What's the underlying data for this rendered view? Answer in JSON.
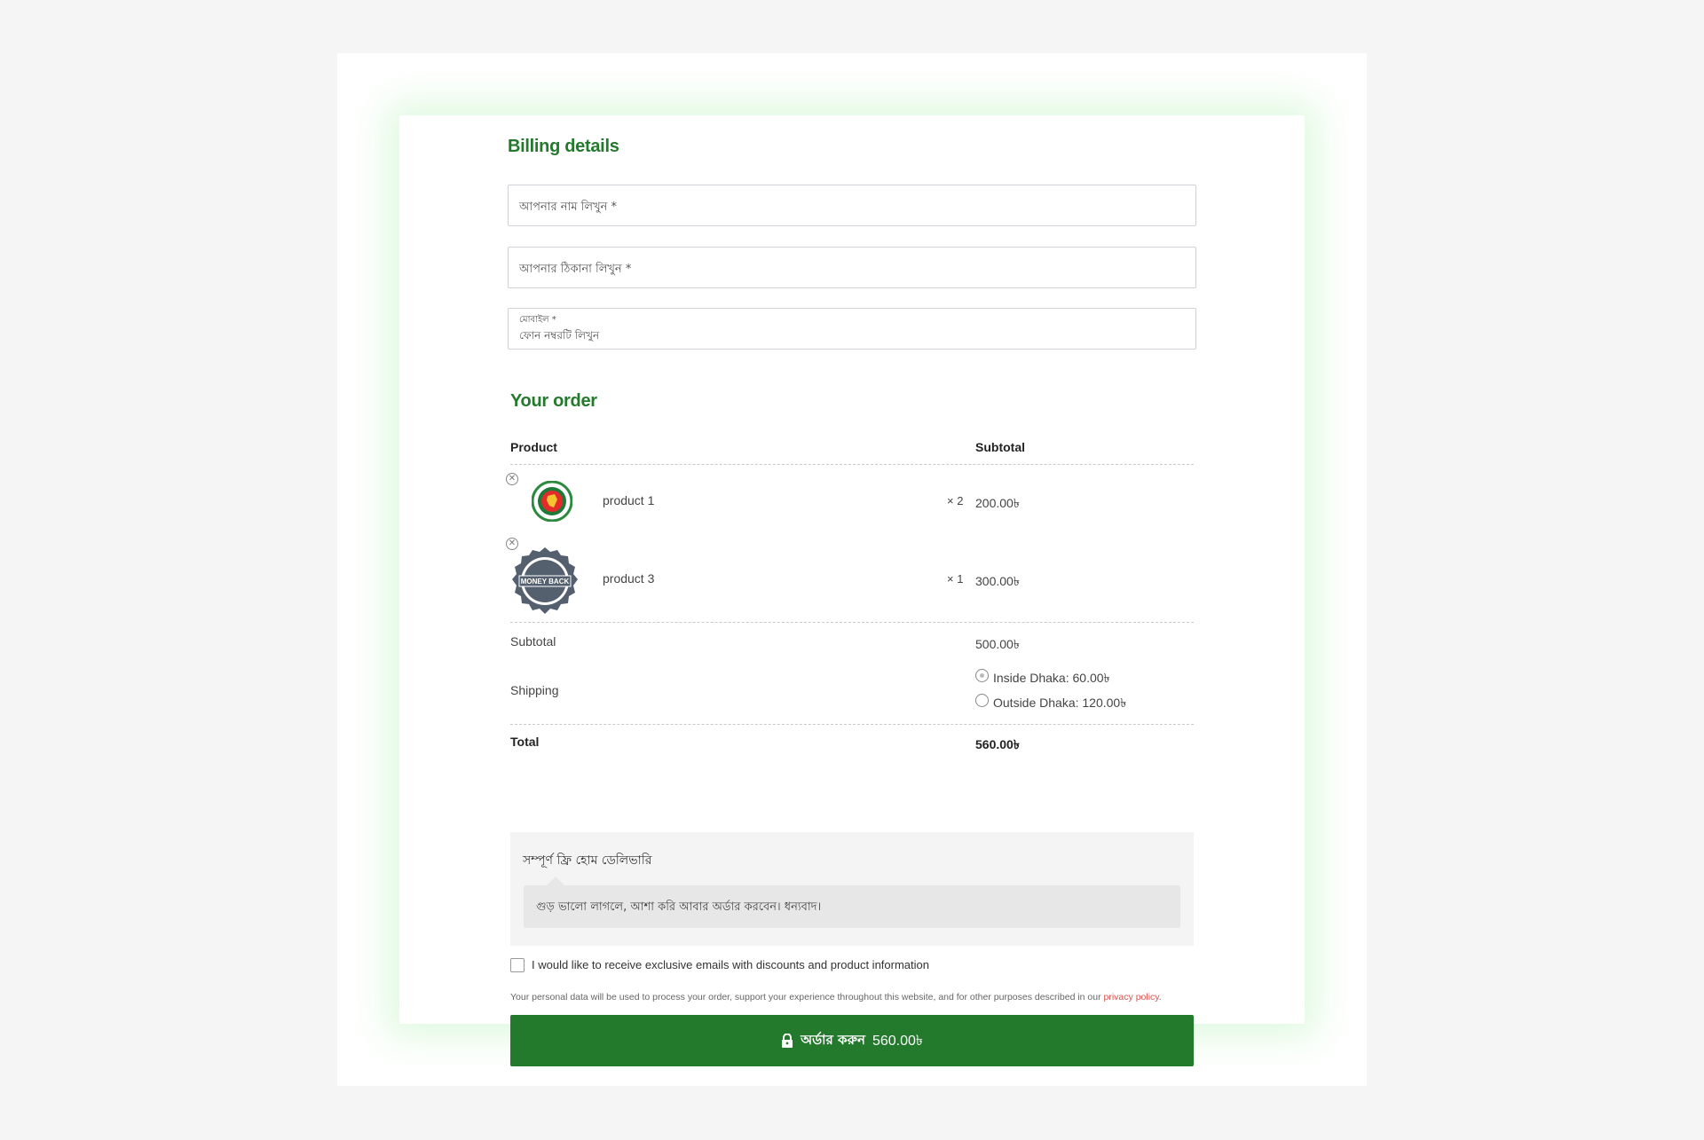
{
  "billing": {
    "title": "Billing details",
    "name_placeholder": "আপনার নাম লিখুন *",
    "address_placeholder": "আপনার ঠিকানা লিখুন *",
    "mobile_label": "মোবাইল *",
    "mobile_placeholder": "ফোন নম্বরটি লিখুন"
  },
  "order": {
    "title": "Your order",
    "headers": {
      "product": "Product",
      "subtotal": "Subtotal"
    },
    "items": [
      {
        "name": "product 1",
        "qty": "× 2",
        "price": "200.00৳",
        "icon": "bangladesh-govt-seal-icon"
      },
      {
        "name": "product 3",
        "qty": "× 1",
        "price": "300.00৳",
        "icon": "money-back-badge-icon",
        "badge_text": "MONEY BACK"
      }
    ],
    "subtotal_label": "Subtotal",
    "subtotal_value": "500.00৳",
    "shipping_label": "Shipping",
    "shipping_options": [
      {
        "label": "Inside Dhaka: 60.00৳",
        "selected": true
      },
      {
        "label": "Outside Dhaka: 120.00৳",
        "selected": false
      }
    ],
    "total_label": "Total",
    "total_value": "560.00৳"
  },
  "note": {
    "title": "সম্পূর্ণ ফ্রি হোম ডেলিভারি",
    "message": "গুড় ভালো লাগলে, আশা করি আবার অর্ডার করবেন। ধন্যবাদ।"
  },
  "newsletter_label": "I would like to receive exclusive emails with discounts and product information",
  "privacy": {
    "text": "Your personal data will be used to process your order, support your experience throughout this website, and for other purposes described in our ",
    "link": "privacy policy",
    "end": "."
  },
  "place_order": {
    "label": "অর্ডার করুন",
    "amount": "560.00৳"
  },
  "colors": {
    "accent": "#237a2c",
    "link": "#d9534f"
  }
}
